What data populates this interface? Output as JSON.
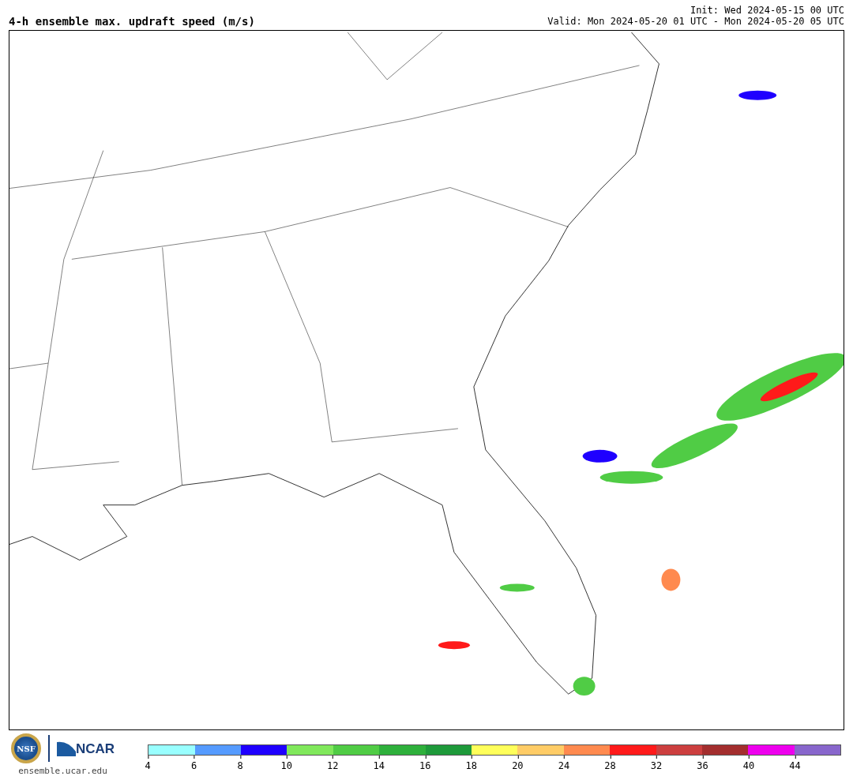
{
  "title": "4-h ensemble max. updraft speed (m/s)",
  "init": "Init: Wed 2024-05-15 00 UTC",
  "valid": "Valid: Mon 2024-05-20 01 UTC - Mon 2024-05-20 05 UTC",
  "logos": {
    "nsf": "NSF",
    "ncar": "NCAR",
    "url": "ensemble.ucar.edu"
  },
  "colorbar": {
    "segments": [
      {
        "color": "#99ffff"
      },
      {
        "color": "#559bff"
      },
      {
        "color": "#1f00ff"
      },
      {
        "color": "#80e85b"
      },
      {
        "color": "#50cc45"
      },
      {
        "color": "#2eb03b"
      },
      {
        "color": "#1e9a3a"
      },
      {
        "color": "#ffff5a"
      },
      {
        "color": "#ffcc66"
      },
      {
        "color": "#ff8a4f"
      },
      {
        "color": "#ff1a1a"
      },
      {
        "color": "#cc3f3f"
      },
      {
        "color": "#a32e2e"
      },
      {
        "color": "#ee00ee"
      },
      {
        "color": "#8866cc"
      }
    ],
    "ticks": [
      "4",
      "6",
      "8",
      "10",
      "12",
      "14",
      "16",
      "18",
      "20",
      "24",
      "28",
      "32",
      "36",
      "40",
      "44"
    ]
  }
}
